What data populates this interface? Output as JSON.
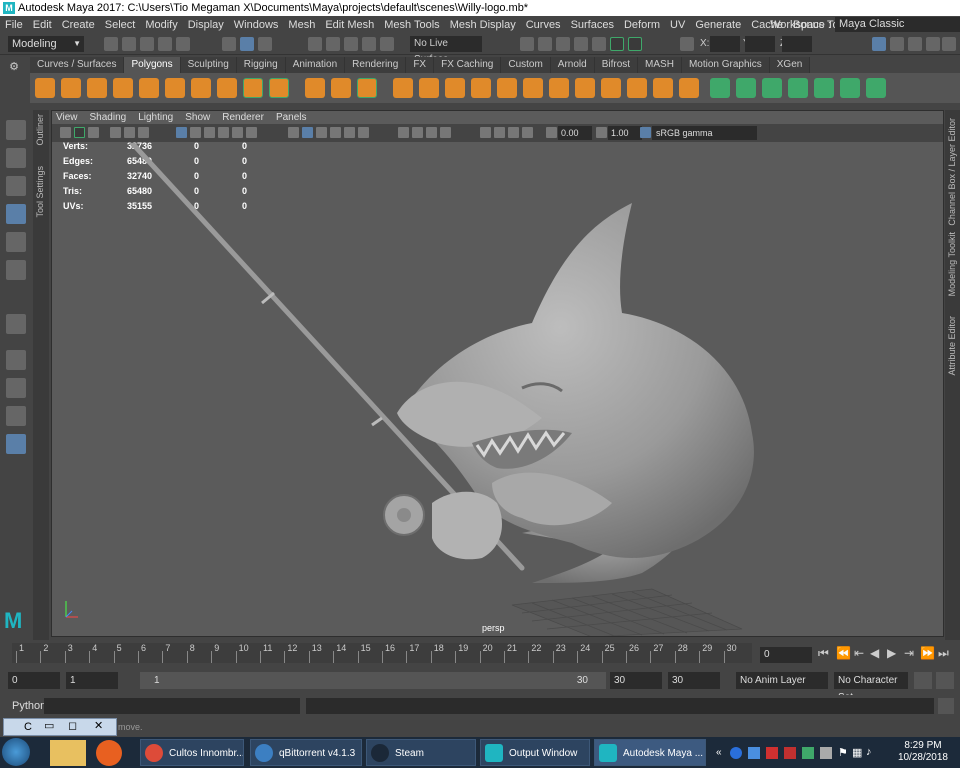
{
  "titlebar": {
    "title": "Autodesk Maya 2017: C:\\Users\\Tio Megaman X\\Documents\\Maya\\projects\\default\\scenes\\Willy-logo.mb*"
  },
  "menu": [
    "File",
    "Edit",
    "Create",
    "Select",
    "Modify",
    "Display",
    "Windows",
    "Mesh",
    "Edit Mesh",
    "Mesh Tools",
    "Mesh Display",
    "Curves",
    "Surfaces",
    "Deform",
    "UV",
    "Generate",
    "Cache",
    "Bonus Tools"
  ],
  "workspace": {
    "label": "Workspace :",
    "value": "Maya Classic"
  },
  "statusline": {
    "mode": "Modeling",
    "live_surface": "No Live Surface",
    "x": "X:",
    "y": "Y:",
    "z": "Z:"
  },
  "shelf_tabs": [
    "Curves / Surfaces",
    "Polygons",
    "Sculpting",
    "Rigging",
    "Animation",
    "Rendering",
    "FX",
    "FX Caching",
    "Custom",
    "Arnold",
    "Bifrost",
    "MASH",
    "Motion Graphics",
    "XGen"
  ],
  "side_left": {
    "outliner": "Outliner",
    "tool_settings": "Tool Settings"
  },
  "side_right": {
    "channel_box": "Channel Box / Layer Editor",
    "modeling_toolkit": "Modeling Toolkit",
    "attribute_editor": "Attribute Editor"
  },
  "viewport": {
    "menu": [
      "View",
      "Shading",
      "Lighting",
      "Show",
      "Renderer",
      "Panels"
    ],
    "exposure": "0.00",
    "gamma_value": "1.00",
    "color_space": "sRGB gamma",
    "camera": "persp",
    "hud": [
      {
        "label": "Verts:",
        "v1": "32736",
        "v2": "0",
        "v3": "0"
      },
      {
        "label": "Edges:",
        "v1": "65480",
        "v2": "0",
        "v3": "0"
      },
      {
        "label": "Faces:",
        "v1": "32740",
        "v2": "0",
        "v3": "0"
      },
      {
        "label": "Tris:",
        "v1": "65480",
        "v2": "0",
        "v3": "0"
      },
      {
        "label": "UVs:",
        "v1": "35155",
        "v2": "0",
        "v3": "0"
      }
    ]
  },
  "timeslider": {
    "ticks": [
      "1",
      "2",
      "3",
      "4",
      "5",
      "6",
      "7",
      "8",
      "9",
      "10",
      "11",
      "12",
      "13",
      "14",
      "15",
      "16",
      "17",
      "18",
      "19",
      "20",
      "21",
      "22",
      "23",
      "24",
      "25",
      "26",
      "27",
      "28",
      "29",
      "30"
    ],
    "current_frame": "0"
  },
  "range": {
    "start": "0",
    "playback_start": "1",
    "slider_start": "1",
    "slider_end": "30",
    "playback_end": "30",
    "end": "30",
    "anim_layer": "No Anim Layer",
    "char_set": "No Character Set"
  },
  "cmdline": {
    "lang": "Python"
  },
  "helpline": {
    "text": "move."
  },
  "floatwin": {
    "label": "C"
  },
  "taskbar": {
    "items": [
      "Cultos Innombr...",
      "qBittorrent v4.1.3",
      "Steam",
      "Output Window",
      "Autodesk Maya ..."
    ],
    "time": "8:29 PM",
    "date": "10/28/2018"
  },
  "colors": {
    "accent": "#5a7fa8",
    "shelf_orange": "#e08a2a",
    "shelf_green": "#3fa86a"
  }
}
